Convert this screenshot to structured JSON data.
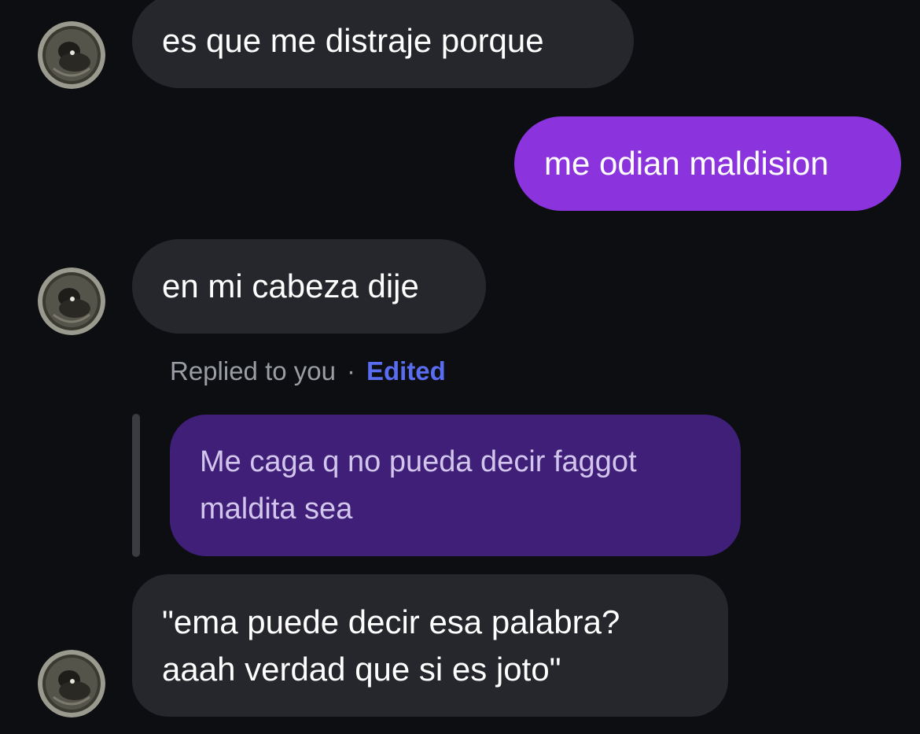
{
  "thread": {
    "messages": [
      {
        "sender": "other",
        "text": "es que me distraje porque"
      },
      {
        "sender": "self",
        "text": "me odian maldision"
      },
      {
        "sender": "other",
        "text": "en mi cabeza dije"
      },
      {
        "sender": "other",
        "reply_meta": {
          "replied_label": "Replied to you",
          "separator": "·",
          "edited_label": "Edited"
        },
        "quoted_text": "Me caga q no pueda decir faggot maldita sea",
        "text": "\"ema puede decir esa palabra? aaah verdad que si es joto\""
      }
    ]
  },
  "colors": {
    "background": "#0c0e12",
    "incoming_bubble": "#25272c",
    "outgoing_bubble": "#8b34de",
    "quoted_bubble": "#3f1f78",
    "edited_accent": "#5a6cf0"
  },
  "icons": {
    "avatar": "avatar-image"
  }
}
